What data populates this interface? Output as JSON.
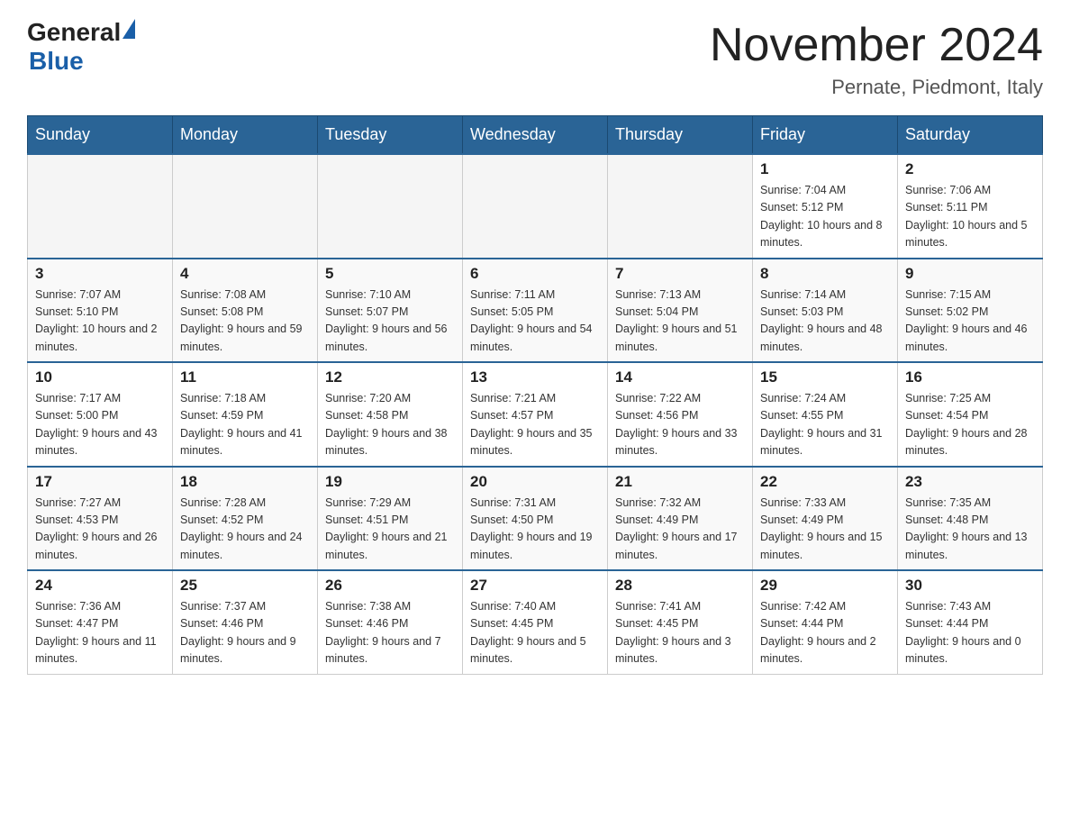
{
  "header": {
    "logo_text": "General",
    "logo_blue": "Blue",
    "month_title": "November 2024",
    "location": "Pernate, Piedmont, Italy"
  },
  "weekdays": [
    "Sunday",
    "Monday",
    "Tuesday",
    "Wednesday",
    "Thursday",
    "Friday",
    "Saturday"
  ],
  "weeks": [
    [
      {
        "day": "",
        "info": ""
      },
      {
        "day": "",
        "info": ""
      },
      {
        "day": "",
        "info": ""
      },
      {
        "day": "",
        "info": ""
      },
      {
        "day": "",
        "info": ""
      },
      {
        "day": "1",
        "info": "Sunrise: 7:04 AM\nSunset: 5:12 PM\nDaylight: 10 hours and 8 minutes."
      },
      {
        "day": "2",
        "info": "Sunrise: 7:06 AM\nSunset: 5:11 PM\nDaylight: 10 hours and 5 minutes."
      }
    ],
    [
      {
        "day": "3",
        "info": "Sunrise: 7:07 AM\nSunset: 5:10 PM\nDaylight: 10 hours and 2 minutes."
      },
      {
        "day": "4",
        "info": "Sunrise: 7:08 AM\nSunset: 5:08 PM\nDaylight: 9 hours and 59 minutes."
      },
      {
        "day": "5",
        "info": "Sunrise: 7:10 AM\nSunset: 5:07 PM\nDaylight: 9 hours and 56 minutes."
      },
      {
        "day": "6",
        "info": "Sunrise: 7:11 AM\nSunset: 5:05 PM\nDaylight: 9 hours and 54 minutes."
      },
      {
        "day": "7",
        "info": "Sunrise: 7:13 AM\nSunset: 5:04 PM\nDaylight: 9 hours and 51 minutes."
      },
      {
        "day": "8",
        "info": "Sunrise: 7:14 AM\nSunset: 5:03 PM\nDaylight: 9 hours and 48 minutes."
      },
      {
        "day": "9",
        "info": "Sunrise: 7:15 AM\nSunset: 5:02 PM\nDaylight: 9 hours and 46 minutes."
      }
    ],
    [
      {
        "day": "10",
        "info": "Sunrise: 7:17 AM\nSunset: 5:00 PM\nDaylight: 9 hours and 43 minutes."
      },
      {
        "day": "11",
        "info": "Sunrise: 7:18 AM\nSunset: 4:59 PM\nDaylight: 9 hours and 41 minutes."
      },
      {
        "day": "12",
        "info": "Sunrise: 7:20 AM\nSunset: 4:58 PM\nDaylight: 9 hours and 38 minutes."
      },
      {
        "day": "13",
        "info": "Sunrise: 7:21 AM\nSunset: 4:57 PM\nDaylight: 9 hours and 35 minutes."
      },
      {
        "day": "14",
        "info": "Sunrise: 7:22 AM\nSunset: 4:56 PM\nDaylight: 9 hours and 33 minutes."
      },
      {
        "day": "15",
        "info": "Sunrise: 7:24 AM\nSunset: 4:55 PM\nDaylight: 9 hours and 31 minutes."
      },
      {
        "day": "16",
        "info": "Sunrise: 7:25 AM\nSunset: 4:54 PM\nDaylight: 9 hours and 28 minutes."
      }
    ],
    [
      {
        "day": "17",
        "info": "Sunrise: 7:27 AM\nSunset: 4:53 PM\nDaylight: 9 hours and 26 minutes."
      },
      {
        "day": "18",
        "info": "Sunrise: 7:28 AM\nSunset: 4:52 PM\nDaylight: 9 hours and 24 minutes."
      },
      {
        "day": "19",
        "info": "Sunrise: 7:29 AM\nSunset: 4:51 PM\nDaylight: 9 hours and 21 minutes."
      },
      {
        "day": "20",
        "info": "Sunrise: 7:31 AM\nSunset: 4:50 PM\nDaylight: 9 hours and 19 minutes."
      },
      {
        "day": "21",
        "info": "Sunrise: 7:32 AM\nSunset: 4:49 PM\nDaylight: 9 hours and 17 minutes."
      },
      {
        "day": "22",
        "info": "Sunrise: 7:33 AM\nSunset: 4:49 PM\nDaylight: 9 hours and 15 minutes."
      },
      {
        "day": "23",
        "info": "Sunrise: 7:35 AM\nSunset: 4:48 PM\nDaylight: 9 hours and 13 minutes."
      }
    ],
    [
      {
        "day": "24",
        "info": "Sunrise: 7:36 AM\nSunset: 4:47 PM\nDaylight: 9 hours and 11 minutes."
      },
      {
        "day": "25",
        "info": "Sunrise: 7:37 AM\nSunset: 4:46 PM\nDaylight: 9 hours and 9 minutes."
      },
      {
        "day": "26",
        "info": "Sunrise: 7:38 AM\nSunset: 4:46 PM\nDaylight: 9 hours and 7 minutes."
      },
      {
        "day": "27",
        "info": "Sunrise: 7:40 AM\nSunset: 4:45 PM\nDaylight: 9 hours and 5 minutes."
      },
      {
        "day": "28",
        "info": "Sunrise: 7:41 AM\nSunset: 4:45 PM\nDaylight: 9 hours and 3 minutes."
      },
      {
        "day": "29",
        "info": "Sunrise: 7:42 AM\nSunset: 4:44 PM\nDaylight: 9 hours and 2 minutes."
      },
      {
        "day": "30",
        "info": "Sunrise: 7:43 AM\nSunset: 4:44 PM\nDaylight: 9 hours and 0 minutes."
      }
    ]
  ]
}
